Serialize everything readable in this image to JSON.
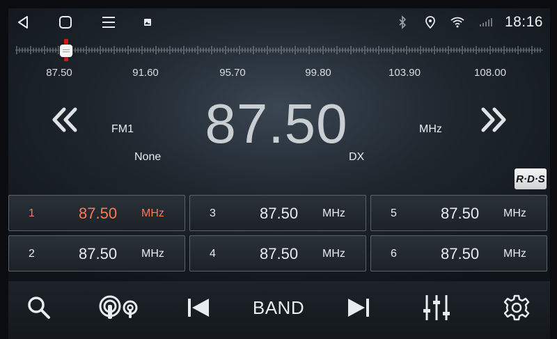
{
  "status_bar": {
    "time": "18:16",
    "icons": [
      "back-icon",
      "home-icon",
      "menu-icon",
      "image-icon",
      "bluetooth-icon",
      "location-icon",
      "wifi-icon",
      "signal-icon"
    ]
  },
  "tuner": {
    "scale_labels": [
      "87.50",
      "91.60",
      "95.70",
      "99.80",
      "103.90",
      "108.00"
    ],
    "current_frequency": "87.50",
    "band": "FM1",
    "unit": "MHz",
    "station_name": "None",
    "reception_mode": "DX",
    "rds_badge": "R·D·S",
    "position_fraction": 0.0
  },
  "presets": [
    {
      "number": "1",
      "frequency": "87.50",
      "unit": "MHz",
      "active": true
    },
    {
      "number": "2",
      "frequency": "87.50",
      "unit": "MHz",
      "active": false
    },
    {
      "number": "3",
      "frequency": "87.50",
      "unit": "MHz",
      "active": false
    },
    {
      "number": "4",
      "frequency": "87.50",
      "unit": "MHz",
      "active": false
    },
    {
      "number": "5",
      "frequency": "87.50",
      "unit": "MHz",
      "active": false
    },
    {
      "number": "6",
      "frequency": "87.50",
      "unit": "MHz",
      "active": false
    }
  ],
  "toolbar": {
    "band_label": "BAND",
    "icons": [
      "search-icon",
      "broadcast-icon",
      "previous-icon",
      "next-icon",
      "equalizer-icon",
      "settings-icon"
    ]
  },
  "colors": {
    "active_preset": "#ff7a55",
    "marker": "#d21a1a",
    "text": "#e8ecef"
  }
}
